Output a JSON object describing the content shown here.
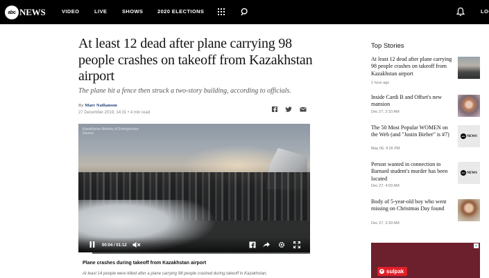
{
  "nav": {
    "logo_circle": "abc",
    "logo_word": "NEWS",
    "items": [
      "VIDEO",
      "LIVE",
      "SHOWS",
      "2020 ELECTIONS"
    ],
    "login": "LOG"
  },
  "article": {
    "headline": "At least 12 dead after plane carrying 98 people crashes on takeoff from Kazakhstan airport",
    "subhead": "The plane hit a fence then struck a two-story building, according to officials.",
    "by_prefix": "By ",
    "author": "Marc Nathanson",
    "dateline": "27 December 2019, 14:31 • 4 min read",
    "share_icons": [
      "facebook-icon",
      "twitter-icon",
      "email-icon"
    ]
  },
  "video": {
    "watermark_line1": "Kazakhstan Ministry of Emergencies",
    "watermark_line2": "Source",
    "current_time": "00:04",
    "duration": "01:12",
    "progress": 0.06,
    "caption_title": "Plane crashes during takeoff from Kazakhstan airport",
    "caption_desc": "At least 14 people were killed after a plane carrying 98 people crashed during takeoff in Kazakhstan,"
  },
  "top_stories": {
    "title": "Top Stories",
    "items": [
      {
        "headline": "At least 12 dead after plane carrying 98 people crashes on takeoff from Kazakhstan airport",
        "time": "1 hour ago",
        "thumb": "photo"
      },
      {
        "headline": "Inside Cardi B and Offset's new mansion",
        "time": "Dec 27, 2:10 AM",
        "thumb": "photo"
      },
      {
        "headline": "The 50 Most Popular WOMEN on the Web (and \"Justin Bieber\" is #7)",
        "time": "May 06, 9:26 PM",
        "thumb": "abc"
      },
      {
        "headline": "Person wanted in connection to Barnard student's murder has been located",
        "time": "Dec 27, 4:03 AM",
        "thumb": "abc"
      },
      {
        "headline": "Body of 5-year-old boy who went missing on Christmas Day found",
        "time": "Dec 27, 2:33 AM",
        "thumb": "photo"
      }
    ]
  },
  "ad": {
    "brand": "sulpak",
    "close": "×"
  },
  "colors": {
    "nav_bg": "#000000",
    "author_link": "#1a3d6e",
    "ad_brand": "#e2202a"
  }
}
